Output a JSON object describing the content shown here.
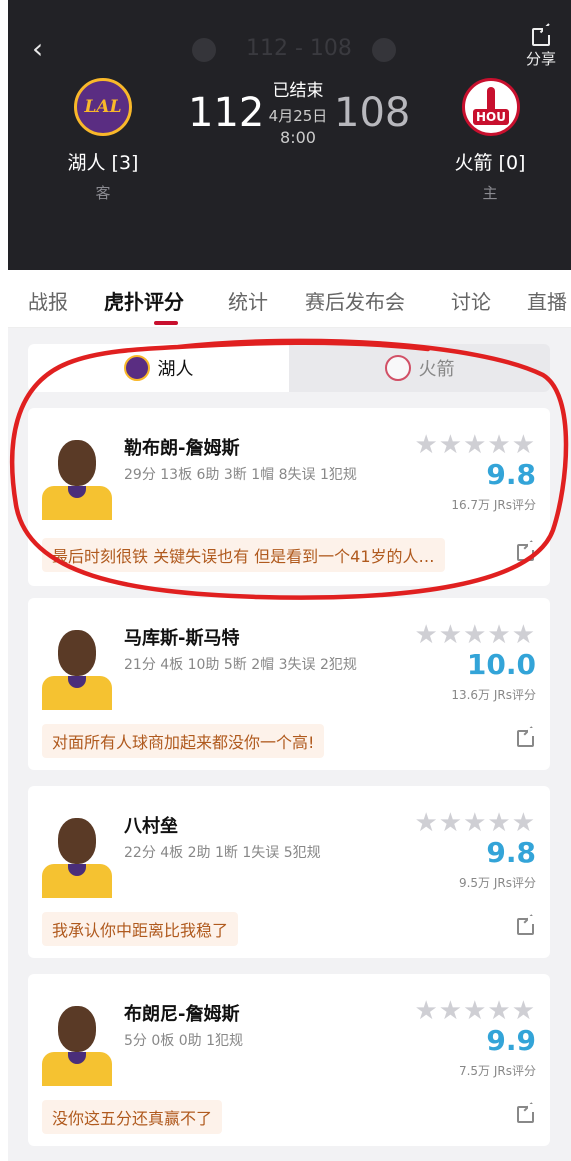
{
  "header": {
    "ghost_score": "112 - 108",
    "share_label": "分享",
    "away": {
      "name": "湖人 [3]",
      "side": "客",
      "score": "112",
      "logo": "LAL"
    },
    "home": {
      "name": "火箭 [0]",
      "side": "主",
      "score": "108",
      "logo": "HOU"
    },
    "status": "已结束",
    "date": "4月25日",
    "time": "8:00"
  },
  "tabs": [
    "战报",
    "虎扑评分",
    "统计",
    "赛后发布会",
    "讨论",
    "直播"
  ],
  "active_tab": "虎扑评分",
  "team_tabs": [
    {
      "label": "湖人",
      "active": true
    },
    {
      "label": "火箭",
      "active": false
    }
  ],
  "players": [
    {
      "name": "勒布朗-詹姆斯",
      "stats": "29分 13板 6助 3断 1帽 8失误 1犯规",
      "rating": "9.8",
      "votes": "16.7万 JRs评分",
      "comment": "最后时刻很铁 关键失误也有 但是看到一个41岁的人…"
    },
    {
      "name": "马库斯-斯马特",
      "stats": "21分 4板 10助 5断 2帽 3失误 2犯规",
      "rating": "10.0",
      "votes": "13.6万 JRs评分",
      "comment": "对面所有人球商加起来都没你一个高!"
    },
    {
      "name": "八村垒",
      "stats": "22分 4板 2助 1断 1失误 5犯规",
      "rating": "9.8",
      "votes": "9.5万 JRs评分",
      "comment": "我承认你中距离比我稳了"
    },
    {
      "name": "布朗尼-詹姆斯",
      "stats": "5分 0板 0助 1犯规",
      "rating": "9.9",
      "votes": "7.5万 JRs评分",
      "comment": "没你这五分还真赢不了"
    }
  ],
  "colors": {
    "rating": "#33a4d8",
    "accent": "#c8102e",
    "annotation_circle": "#e02020"
  },
  "stars_glyph": "★★★★★"
}
